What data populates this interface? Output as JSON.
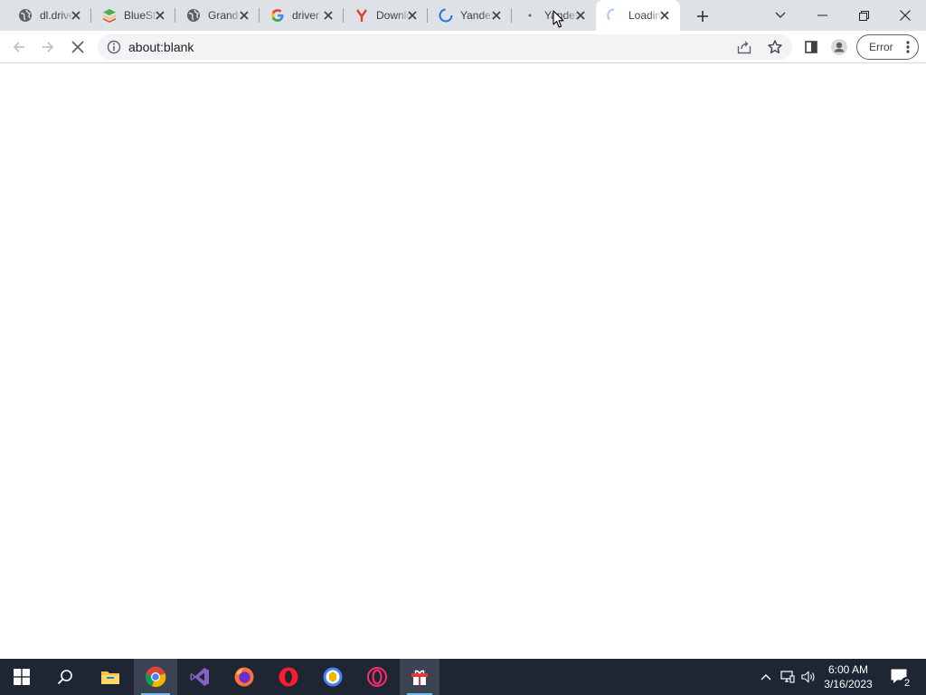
{
  "browser": {
    "tabs": [
      {
        "title": "dl.driver",
        "favicon": "globe-icon",
        "active": false
      },
      {
        "title": "BlueStacks",
        "favicon": "bluestacks-icon",
        "active": false
      },
      {
        "title": "Grand",
        "favicon": "globe-icon",
        "active": false
      },
      {
        "title": "driver",
        "favicon": "google-icon",
        "active": false
      },
      {
        "title": "Download",
        "favicon": "yandex-icon",
        "active": false
      },
      {
        "title": "Yandex",
        "favicon": "loading-spinner-icon",
        "active": false
      },
      {
        "title": "Yandex",
        "favicon": "loading-dot-icon",
        "active": false
      },
      {
        "title": "Loading",
        "favicon": "loading-spinner-icon",
        "active": true
      }
    ],
    "address_bar": {
      "url": "about:blank"
    },
    "profile_button": {
      "label": "Error"
    },
    "colors": {
      "tabstrip": "#dee1e6",
      "omnibox": "#f1f3f4",
      "accent": "#1a73e8"
    }
  },
  "taskbar": {
    "apps": [
      "start-icon",
      "search-icon",
      "file-explorer-icon",
      "chrome-icon",
      "visual-studio-icon",
      "firefox-icon",
      "opera-icon",
      "brave-icon",
      "opera-gx-icon",
      "app-icon"
    ],
    "clock": {
      "time": "6:00 AM",
      "date": "3/16/2023"
    },
    "notifications": {
      "count": "2"
    }
  }
}
